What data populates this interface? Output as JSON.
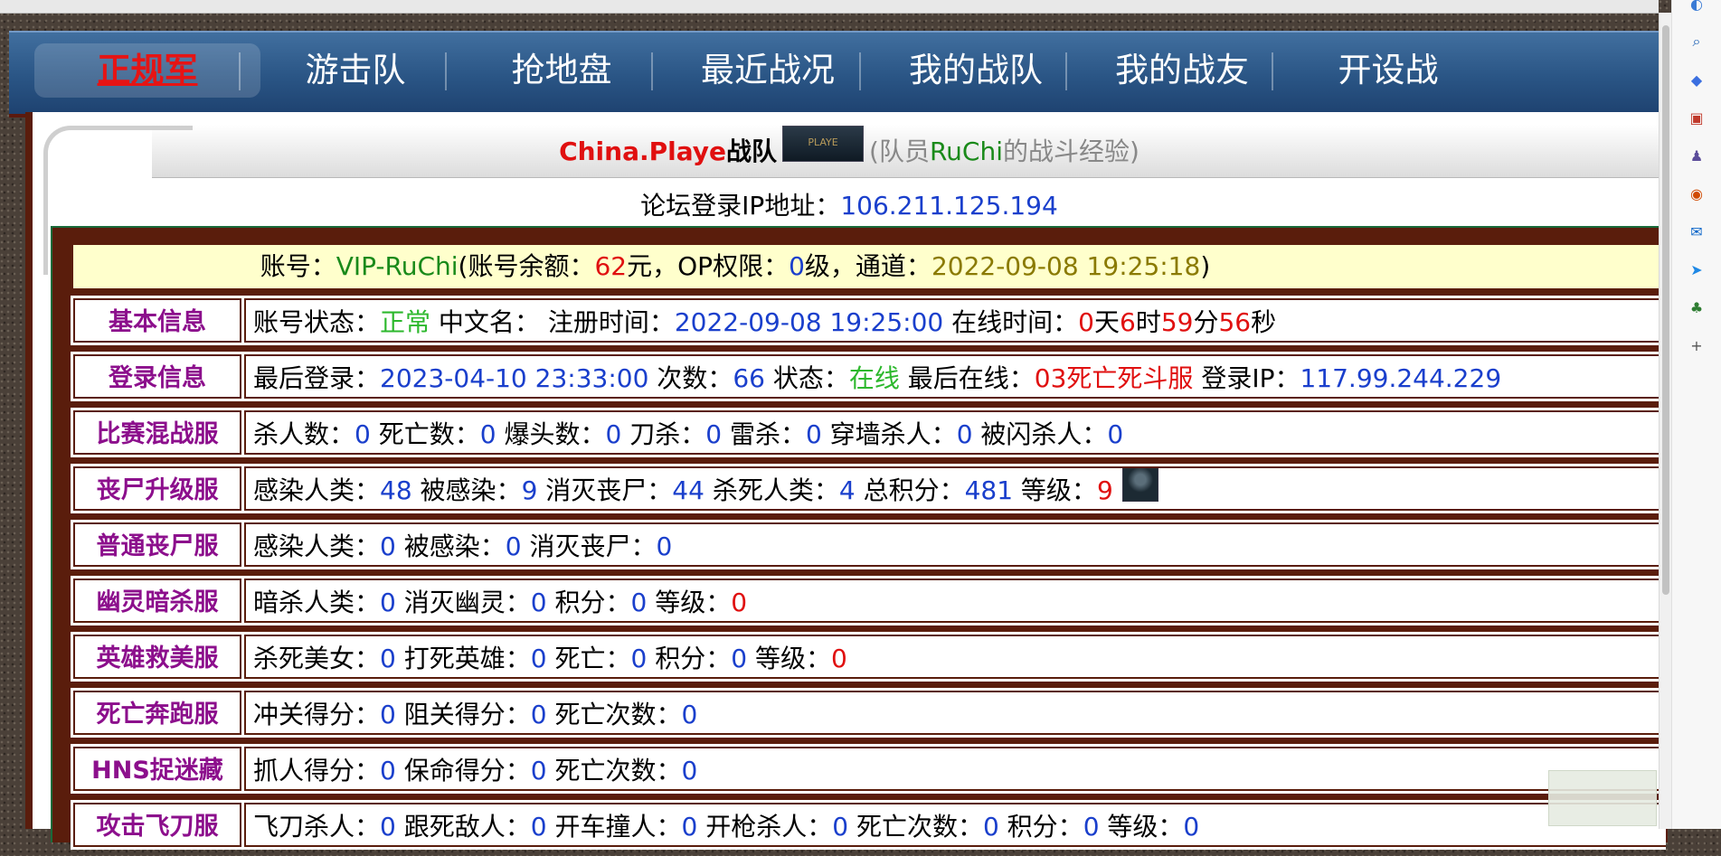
{
  "nav": {
    "items": [
      {
        "label": "正规军",
        "active": true
      },
      {
        "label": "游击队",
        "active": false
      },
      {
        "label": "抢地盘",
        "active": false
      },
      {
        "label": "最近战况",
        "active": false
      },
      {
        "label": "我的战队",
        "active": false
      },
      {
        "label": "我的战友",
        "active": false
      },
      {
        "label": "开设战",
        "active": false
      }
    ]
  },
  "title": {
    "team": "China.Playe",
    "suffix": "战队",
    "logo_text": "PLAYE",
    "member_prefix": "(队员",
    "member_name": "RuChi",
    "member_suffix": "的战斗经验)"
  },
  "ip_line": {
    "label": "论坛登录IP地址：",
    "ip": "106.211.125.194"
  },
  "account": {
    "label": "账号：",
    "id": "VIP-RuChi",
    "balance_label": "(账号余额：",
    "balance": "62",
    "balance_unit": "元，",
    "op_label": "OP权限：",
    "op": "0",
    "op_unit": "级，",
    "channel_label": "通道：",
    "channel": "2022-09-08 19:25:18",
    "close": ")"
  },
  "rows": [
    {
      "label": "基本信息",
      "parts": [
        {
          "t": "账号状态："
        },
        {
          "t": "正常",
          "c": "green"
        },
        {
          "t": " 中文名： 注册时间："
        },
        {
          "t": "2022-09-08 19:25:00",
          "c": "blue"
        },
        {
          "t": " 在线时间："
        },
        {
          "t": "0",
          "c": "red"
        },
        {
          "t": "天"
        },
        {
          "t": "6",
          "c": "red"
        },
        {
          "t": "时"
        },
        {
          "t": "59",
          "c": "red"
        },
        {
          "t": "分"
        },
        {
          "t": "56",
          "c": "red"
        },
        {
          "t": "秒"
        }
      ]
    },
    {
      "label": "登录信息",
      "parts": [
        {
          "t": "最后登录："
        },
        {
          "t": "2023-04-10 23:33:00",
          "c": "blue"
        },
        {
          "t": " 次数："
        },
        {
          "t": "66",
          "c": "blue"
        },
        {
          "t": " 状态："
        },
        {
          "t": "在线",
          "c": "green"
        },
        {
          "t": " 最后在线："
        },
        {
          "t": "03死亡死斗服",
          "c": "red"
        },
        {
          "t": " 登录IP："
        },
        {
          "t": "117.99.244.229",
          "c": "blue"
        }
      ]
    },
    {
      "label": "比赛混战服",
      "parts": [
        {
          "t": "杀人数："
        },
        {
          "t": "0",
          "c": "blue"
        },
        {
          "t": " 死亡数："
        },
        {
          "t": "0",
          "c": "blue"
        },
        {
          "t": " 爆头数："
        },
        {
          "t": "0",
          "c": "blue"
        },
        {
          "t": " 刀杀："
        },
        {
          "t": "0",
          "c": "blue"
        },
        {
          "t": " 雷杀："
        },
        {
          "t": "0",
          "c": "blue"
        },
        {
          "t": " 穿墙杀人："
        },
        {
          "t": "0",
          "c": "blue"
        },
        {
          "t": " 被闪杀人："
        },
        {
          "t": "0",
          "c": "blue"
        }
      ]
    },
    {
      "label": "丧尸升级服",
      "icon": true,
      "parts": [
        {
          "t": "感染人类："
        },
        {
          "t": "48",
          "c": "blue"
        },
        {
          "t": " 被感染："
        },
        {
          "t": "9",
          "c": "blue"
        },
        {
          "t": " 消灭丧尸："
        },
        {
          "t": "44",
          "c": "blue"
        },
        {
          "t": " 杀死人类："
        },
        {
          "t": "4",
          "c": "blue"
        },
        {
          "t": " 总积分："
        },
        {
          "t": "481",
          "c": "blue"
        },
        {
          "t": " 等级："
        },
        {
          "t": "9",
          "c": "red"
        }
      ]
    },
    {
      "label": "普通丧尸服",
      "parts": [
        {
          "t": "感染人类："
        },
        {
          "t": "0",
          "c": "blue"
        },
        {
          "t": " 被感染："
        },
        {
          "t": "0",
          "c": "blue"
        },
        {
          "t": " 消灭丧尸："
        },
        {
          "t": "0",
          "c": "blue"
        }
      ]
    },
    {
      "label": "幽灵暗杀服",
      "parts": [
        {
          "t": "暗杀人类："
        },
        {
          "t": "0",
          "c": "blue"
        },
        {
          "t": " 消灭幽灵："
        },
        {
          "t": "0",
          "c": "blue"
        },
        {
          "t": " 积分："
        },
        {
          "t": "0",
          "c": "blue"
        },
        {
          "t": " 等级："
        },
        {
          "t": "0",
          "c": "red"
        }
      ]
    },
    {
      "label": "英雄救美服",
      "parts": [
        {
          "t": "杀死美女："
        },
        {
          "t": "0",
          "c": "blue"
        },
        {
          "t": " 打死英雄："
        },
        {
          "t": "0",
          "c": "blue"
        },
        {
          "t": " 死亡："
        },
        {
          "t": "0",
          "c": "blue"
        },
        {
          "t": " 积分："
        },
        {
          "t": "0",
          "c": "blue"
        },
        {
          "t": " 等级："
        },
        {
          "t": "0",
          "c": "red"
        }
      ]
    },
    {
      "label": "死亡奔跑服",
      "parts": [
        {
          "t": "冲关得分："
        },
        {
          "t": "0",
          "c": "blue"
        },
        {
          "t": " 阻关得分："
        },
        {
          "t": "0",
          "c": "blue"
        },
        {
          "t": " 死亡次数："
        },
        {
          "t": "0",
          "c": "blue"
        }
      ]
    },
    {
      "label": "HNS捉迷藏",
      "parts": [
        {
          "t": "抓人得分："
        },
        {
          "t": "0",
          "c": "blue"
        },
        {
          "t": " 保命得分："
        },
        {
          "t": "0",
          "c": "blue"
        },
        {
          "t": " 死亡次数："
        },
        {
          "t": "0",
          "c": "blue"
        }
      ]
    },
    {
      "label": "攻击飞刀服",
      "parts": [
        {
          "t": "飞刀杀人："
        },
        {
          "t": "0",
          "c": "blue"
        },
        {
          "t": " 跟死敌人："
        },
        {
          "t": "0",
          "c": "blue"
        },
        {
          "t": " 开车撞人："
        },
        {
          "t": "0",
          "c": "blue"
        },
        {
          "t": " 开枪杀人："
        },
        {
          "t": "0",
          "c": "blue"
        },
        {
          "t": " 死亡次数："
        },
        {
          "t": "0",
          "c": "blue"
        },
        {
          "t": " 积分："
        },
        {
          "t": "0",
          "c": "blue"
        },
        {
          "t": " 等级："
        },
        {
          "t": "0",
          "c": "blue"
        }
      ]
    }
  ],
  "sidebar_icons": [
    "copilot-icon",
    "search-icon",
    "tag-icon",
    "briefcase-icon",
    "chess-icon",
    "office-icon",
    "outlook-icon",
    "send-icon",
    "tree-icon",
    "plus-icon"
  ]
}
